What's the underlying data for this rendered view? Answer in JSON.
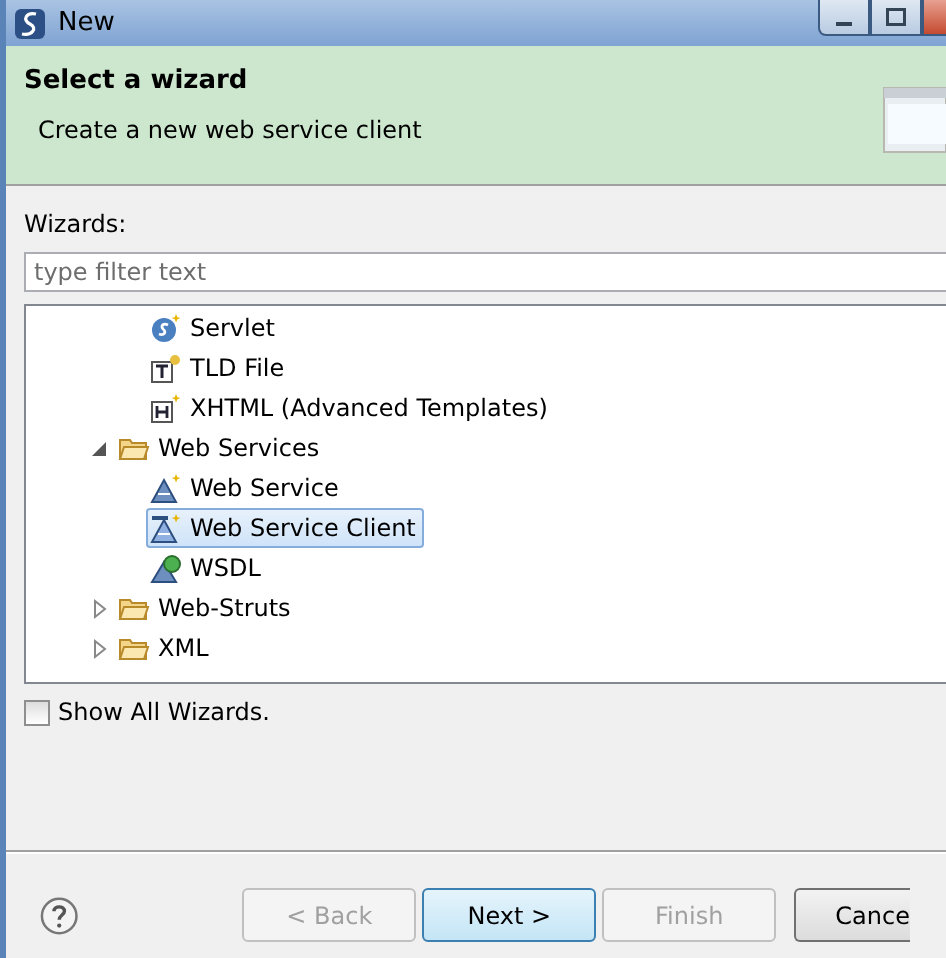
{
  "window": {
    "title": "New"
  },
  "header": {
    "title": "Select a wizard",
    "description": "Create a new web service client"
  },
  "wizards_label": "Wizards:",
  "filter": {
    "placeholder": "type filter text"
  },
  "tree": [
    {
      "kind": "hidden",
      "children": [
        {
          "label": "Servlet",
          "kind": "servlet",
          "selected": false
        },
        {
          "label": "TLD File",
          "kind": "tld",
          "selected": false
        },
        {
          "label": "XHTML (Advanced Templates)",
          "kind": "xhtml",
          "selected": false
        }
      ]
    },
    {
      "label": "Web Services",
      "kind": "folder",
      "expanded": true,
      "children": [
        {
          "label": "Web Service",
          "kind": "webservice",
          "selected": false
        },
        {
          "label": "Web Service Client",
          "kind": "wsclient",
          "selected": true
        },
        {
          "label": "WSDL",
          "kind": "wsdl",
          "selected": false
        }
      ]
    },
    {
      "label": "Web-Struts",
      "kind": "folder",
      "expanded": false
    },
    {
      "label": "XML",
      "kind": "folder",
      "expanded": false
    }
  ],
  "show_all": {
    "label": "Show All Wizards.",
    "checked": false
  },
  "buttons": [
    {
      "label": "< Back",
      "disabled": true,
      "default": false
    },
    {
      "label": "Next >",
      "disabled": false,
      "default": true
    },
    {
      "label": "Finish",
      "disabled": true,
      "default": false
    },
    {
      "label": "Cance",
      "disabled": false,
      "default": false
    }
  ]
}
